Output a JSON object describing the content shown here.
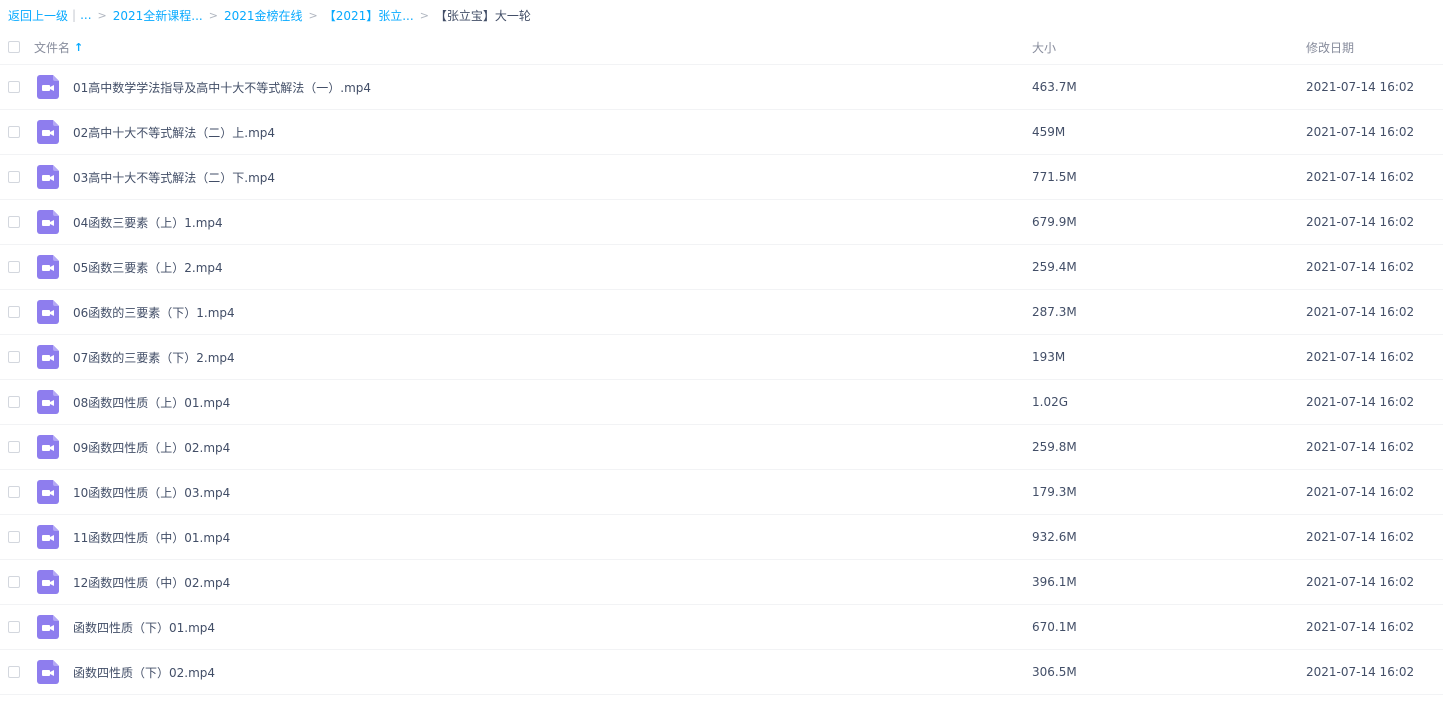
{
  "breadcrumb": {
    "back_label": "返回上一级",
    "bar": "|",
    "ellipsis": "...",
    "items": [
      "2021全新课程...",
      "2021金榜在线",
      "【2021】张立..."
    ],
    "current": "【张立宝】大一轮",
    "sep": ">"
  },
  "header": {
    "name_label": "文件名",
    "sort_icon": "↑",
    "size_label": "大小",
    "date_label": "修改日期"
  },
  "colors": {
    "link": "#09aaff",
    "video_icon": "#8e7dee"
  },
  "files": [
    {
      "icon": "video-file-icon",
      "name": "01高中数学学法指导及高中十大不等式解法（一）.mp4",
      "size": "463.7M",
      "date": "2021-07-14 16:02"
    },
    {
      "icon": "video-file-icon",
      "name": "02高中十大不等式解法（二）上.mp4",
      "size": "459M",
      "date": "2021-07-14 16:02"
    },
    {
      "icon": "video-file-icon",
      "name": "03高中十大不等式解法（二）下.mp4",
      "size": "771.5M",
      "date": "2021-07-14 16:02"
    },
    {
      "icon": "video-file-icon",
      "name": "04函数三要素（上）1.mp4",
      "size": "679.9M",
      "date": "2021-07-14 16:02"
    },
    {
      "icon": "video-file-icon",
      "name": "05函数三要素（上）2.mp4",
      "size": "259.4M",
      "date": "2021-07-14 16:02"
    },
    {
      "icon": "video-file-icon",
      "name": "06函数的三要素（下）1.mp4",
      "size": "287.3M",
      "date": "2021-07-14 16:02"
    },
    {
      "icon": "video-file-icon",
      "name": "07函数的三要素（下）2.mp4",
      "size": "193M",
      "date": "2021-07-14 16:02"
    },
    {
      "icon": "video-file-icon",
      "name": "08函数四性质（上）01.mp4",
      "size": "1.02G",
      "date": "2021-07-14 16:02"
    },
    {
      "icon": "video-file-icon",
      "name": "09函数四性质（上）02.mp4",
      "size": "259.8M",
      "date": "2021-07-14 16:02"
    },
    {
      "icon": "video-file-icon",
      "name": "10函数四性质（上）03.mp4",
      "size": "179.3M",
      "date": "2021-07-14 16:02"
    },
    {
      "icon": "video-file-icon",
      "name": "11函数四性质（中）01.mp4",
      "size": "932.6M",
      "date": "2021-07-14 16:02"
    },
    {
      "icon": "video-file-icon",
      "name": "12函数四性质（中）02.mp4",
      "size": "396.1M",
      "date": "2021-07-14 16:02"
    },
    {
      "icon": "video-file-icon",
      "name": "函数四性质（下）01.mp4",
      "size": "670.1M",
      "date": "2021-07-14 16:02"
    },
    {
      "icon": "video-file-icon",
      "name": "函数四性质（下）02.mp4",
      "size": "306.5M",
      "date": "2021-07-14 16:02"
    }
  ]
}
